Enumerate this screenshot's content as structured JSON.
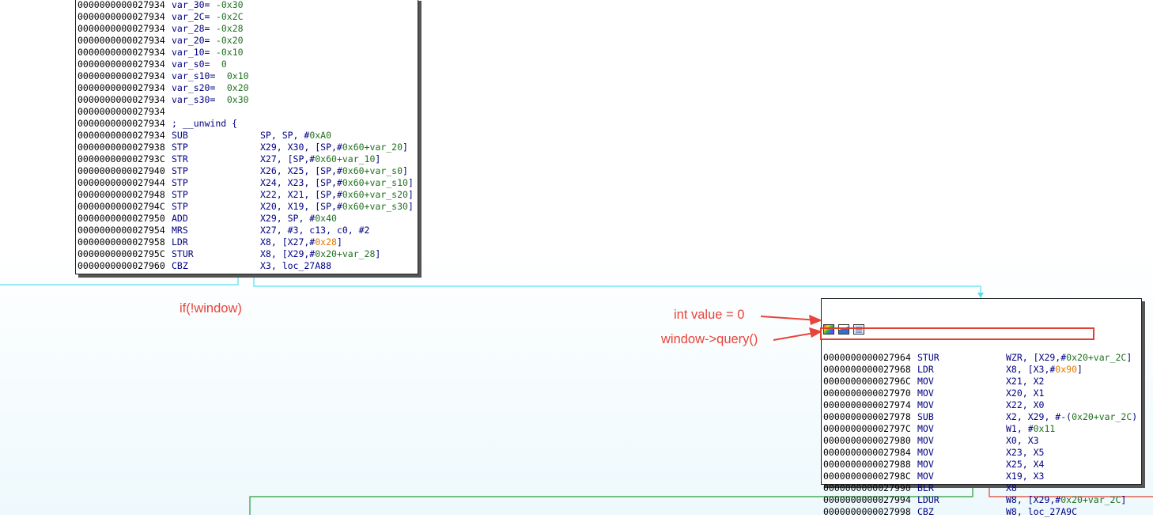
{
  "block1": {
    "lines": [
      {
        "addr": "0000000000027934",
        "mn": "var_30=",
        "ops": [
          {
            "t": " -0x30",
            "c": "g"
          }
        ],
        "style": "var"
      },
      {
        "addr": "0000000000027934",
        "mn": "var_2C=",
        "ops": [
          {
            "t": " -0x2C",
            "c": "g"
          }
        ],
        "style": "var"
      },
      {
        "addr": "0000000000027934",
        "mn": "var_28=",
        "ops": [
          {
            "t": " -0x28",
            "c": "g"
          }
        ],
        "style": "var"
      },
      {
        "addr": "0000000000027934",
        "mn": "var_20=",
        "ops": [
          {
            "t": " -0x20",
            "c": "g"
          }
        ],
        "style": "var"
      },
      {
        "addr": "0000000000027934",
        "mn": "var_10=",
        "ops": [
          {
            "t": " -0x10",
            "c": "g"
          }
        ],
        "style": "var"
      },
      {
        "addr": "0000000000027934",
        "mn": "var_s0=",
        "ops": [
          {
            "t": "  0",
            "c": "g"
          }
        ],
        "style": "var"
      },
      {
        "addr": "0000000000027934",
        "mn": "var_s10=",
        "ops": [
          {
            "t": "  0x10",
            "c": "g"
          }
        ],
        "style": "var"
      },
      {
        "addr": "0000000000027934",
        "mn": "var_s20=",
        "ops": [
          {
            "t": "  0x20",
            "c": "g"
          }
        ],
        "style": "var"
      },
      {
        "addr": "0000000000027934",
        "mn": "var_s30=",
        "ops": [
          {
            "t": "  0x30",
            "c": "g"
          }
        ],
        "style": "var"
      },
      {
        "addr": "0000000000027934",
        "mn": "",
        "ops": [],
        "style": "var"
      },
      {
        "addr": "0000000000027934",
        "mn": "; __unwind {",
        "ops": [],
        "style": "var"
      },
      {
        "addr": "0000000000027934",
        "mn": "SUB",
        "ops": [
          {
            "t": "SP, SP, #",
            "c": "n"
          },
          {
            "t": "0xA0",
            "c": "g"
          }
        ]
      },
      {
        "addr": "0000000000027938",
        "mn": "STP",
        "ops": [
          {
            "t": "X29, X30, [SP,#",
            "c": "n"
          },
          {
            "t": "0x60+var_20",
            "c": "g"
          },
          {
            "t": "]",
            "c": "n"
          }
        ]
      },
      {
        "addr": "000000000002793C",
        "mn": "STR",
        "ops": [
          {
            "t": "X27, [SP,#",
            "c": "n"
          },
          {
            "t": "0x60+var_10",
            "c": "g"
          },
          {
            "t": "]",
            "c": "n"
          }
        ]
      },
      {
        "addr": "0000000000027940",
        "mn": "STP",
        "ops": [
          {
            "t": "X26, X25, [SP,#",
            "c": "n"
          },
          {
            "t": "0x60+var_s0",
            "c": "g"
          },
          {
            "t": "]",
            "c": "n"
          }
        ]
      },
      {
        "addr": "0000000000027944",
        "mn": "STP",
        "ops": [
          {
            "t": "X24, X23, [SP,#",
            "c": "n"
          },
          {
            "t": "0x60+var_s10",
            "c": "g"
          },
          {
            "t": "]",
            "c": "n"
          }
        ]
      },
      {
        "addr": "0000000000027948",
        "mn": "STP",
        "ops": [
          {
            "t": "X22, X21, [SP,#",
            "c": "n"
          },
          {
            "t": "0x60+var_s20",
            "c": "g"
          },
          {
            "t": "]",
            "c": "n"
          }
        ]
      },
      {
        "addr": "000000000002794C",
        "mn": "STP",
        "ops": [
          {
            "t": "X20, X19, [SP,#",
            "c": "n"
          },
          {
            "t": "0x60+var_s30",
            "c": "g"
          },
          {
            "t": "]",
            "c": "n"
          }
        ]
      },
      {
        "addr": "0000000000027950",
        "mn": "ADD",
        "ops": [
          {
            "t": "X29, SP, #",
            "c": "n"
          },
          {
            "t": "0x40",
            "c": "g"
          }
        ]
      },
      {
        "addr": "0000000000027954",
        "mn": "MRS",
        "ops": [
          {
            "t": "X27, #3, c13, c0, #2",
            "c": "n"
          }
        ]
      },
      {
        "addr": "0000000000027958",
        "mn": "LDR",
        "ops": [
          {
            "t": "X8, [X27,#",
            "c": "n"
          },
          {
            "t": "0x28",
            "c": "o"
          },
          {
            "t": "]",
            "c": "n"
          }
        ]
      },
      {
        "addr": "000000000002795C",
        "mn": "STUR",
        "ops": [
          {
            "t": "X8, [X29,#",
            "c": "n"
          },
          {
            "t": "0x20+var_28",
            "c": "g"
          },
          {
            "t": "]",
            "c": "n"
          }
        ]
      },
      {
        "addr": "0000000000027960",
        "mn": "CBZ",
        "ops": [
          {
            "t": "X3, loc_27A88",
            "c": "n"
          }
        ]
      }
    ]
  },
  "block2": {
    "lines": [
      {
        "addr": "0000000000027964",
        "mn": "STUR",
        "ops": [
          {
            "t": "WZR, [X29,#",
            "c": "n"
          },
          {
            "t": "0x20+var_2C",
            "c": "g"
          },
          {
            "t": "]",
            "c": "n"
          }
        ]
      },
      {
        "addr": "0000000000027968",
        "mn": "LDR",
        "ops": [
          {
            "t": "X8, [X3,#",
            "c": "n"
          },
          {
            "t": "0x90",
            "c": "o"
          },
          {
            "t": "]",
            "c": "n"
          }
        ]
      },
      {
        "addr": "000000000002796C",
        "mn": "MOV",
        "ops": [
          {
            "t": "X21, X2",
            "c": "n"
          }
        ]
      },
      {
        "addr": "0000000000027970",
        "mn": "MOV",
        "ops": [
          {
            "t": "X20, X1",
            "c": "n"
          }
        ]
      },
      {
        "addr": "0000000000027974",
        "mn": "MOV",
        "ops": [
          {
            "t": "X22, X0",
            "c": "n"
          }
        ]
      },
      {
        "addr": "0000000000027978",
        "mn": "SUB",
        "ops": [
          {
            "t": "X2, X29, #-(",
            "c": "n"
          },
          {
            "t": "0x20+var_2C",
            "c": "g"
          },
          {
            "t": ")",
            "c": "n"
          }
        ]
      },
      {
        "addr": "000000000002797C",
        "mn": "MOV",
        "ops": [
          {
            "t": "W1, #",
            "c": "n"
          },
          {
            "t": "0x11",
            "c": "g"
          }
        ]
      },
      {
        "addr": "0000000000027980",
        "mn": "MOV",
        "ops": [
          {
            "t": "X0, X3",
            "c": "n"
          }
        ]
      },
      {
        "addr": "0000000000027984",
        "mn": "MOV",
        "ops": [
          {
            "t": "X23, X5",
            "c": "n"
          }
        ]
      },
      {
        "addr": "0000000000027988",
        "mn": "MOV",
        "ops": [
          {
            "t": "X25, X4",
            "c": "n"
          }
        ]
      },
      {
        "addr": "000000000002798C",
        "mn": "MOV",
        "ops": [
          {
            "t": "X19, X3",
            "c": "n"
          }
        ]
      },
      {
        "addr": "0000000000027990",
        "mn": "BLR",
        "ops": [
          {
            "t": "X8",
            "c": "n"
          }
        ]
      },
      {
        "addr": "0000000000027994",
        "mn": "LDUR",
        "ops": [
          {
            "t": "W8, [X29,#",
            "c": "n"
          },
          {
            "t": "0x20+var_2C",
            "c": "g"
          },
          {
            "t": "]",
            "c": "n"
          }
        ]
      },
      {
        "addr": "0000000000027998",
        "mn": "CBZ",
        "ops": [
          {
            "t": "W8, loc_27A9C",
            "c": "n"
          }
        ]
      }
    ]
  },
  "annotations": {
    "if_window": "if(!window)",
    "int_value": "int value = 0",
    "window_query": "window->query()"
  },
  "colors": {
    "annotation": "#e8443a",
    "edge_cyan": "#55e0f0",
    "edge_green": "#2a9a3a",
    "edge_red": "#e04030",
    "operand_green": "#207020",
    "operand_orange": "#e07800",
    "text_navy": "#000080"
  },
  "icons": [
    "graph-color-icon",
    "graph-edit-icon",
    "graph-layout-icon"
  ]
}
